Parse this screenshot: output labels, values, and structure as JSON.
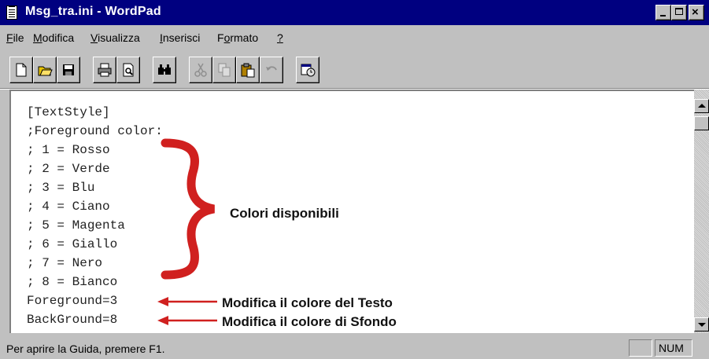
{
  "window": {
    "title": "Msg_tra.ini - WordPad",
    "app_icon": "notepad-document-icon"
  },
  "menu": [
    {
      "label": "File",
      "accel": "F"
    },
    {
      "label": "Modifica",
      "accel": "M"
    },
    {
      "label": "Visualizza",
      "accel": "V"
    },
    {
      "label": "Inserisci",
      "accel": "I"
    },
    {
      "label": "Formato",
      "accel": "o"
    },
    {
      "label": "?",
      "accel": "?"
    }
  ],
  "toolbar": {
    "buttons": [
      "new-icon",
      "open-icon",
      "save-icon",
      "print-icon",
      "print-preview-icon",
      "find-icon",
      "cut-icon",
      "copy-icon",
      "paste-icon",
      "undo-icon",
      "date-time-icon"
    ]
  },
  "document": {
    "lines": [
      "[TextStyle]",
      ";Foreground color:",
      "; 1 = Rosso",
      "; 2 = Verde",
      "; 3 = Blu",
      "; 4 = Ciano",
      "; 5 = Magenta",
      "; 6 = Giallo",
      "; 7 = Nero",
      "; 8 = Bianco",
      "Foreground=3",
      "BackGround=8"
    ]
  },
  "annotations": {
    "brace_label": "Colori disponibili",
    "arrow1_label": "Modifica il colore del Testo",
    "arrow2_label": "Modifica il colore di Sfondo",
    "accent_color": "#d0201f"
  },
  "status": {
    "text": "Per aprire la Guida, premere F1.",
    "num": "NUM"
  }
}
